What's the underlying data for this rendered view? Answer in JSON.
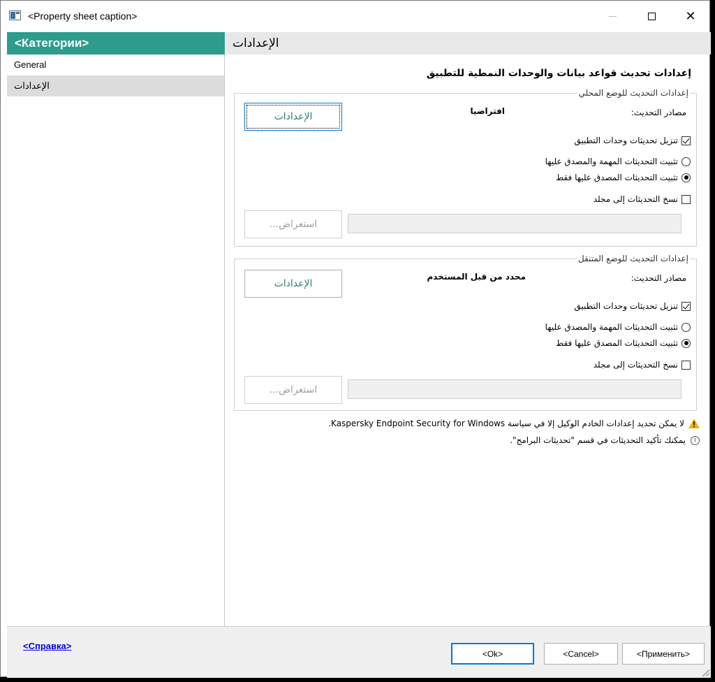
{
  "window": {
    "title": "<Property sheet caption>",
    "controls": {
      "minimize_icon": "minimize-icon",
      "maximize_icon": "maximize-icon",
      "close_glyph": "✕"
    }
  },
  "sidebar": {
    "header": "<Категории>",
    "items": [
      {
        "label": "General",
        "selected": false
      },
      {
        "label": "الإعدادات",
        "selected": true
      }
    ]
  },
  "page": {
    "header": "الإعدادات",
    "title": "إعدادات تحديث قواعد بيانات والوحدات النمطية للتطبيق"
  },
  "local_group": {
    "title": "إعدادات التحديث للوضع المحلي",
    "settings_button": "الإعدادات",
    "source_label": "مصادر التحديث:",
    "source_value": "افتراضيا",
    "download_modules": {
      "label": "تنزيل تحديثات وحدات التطبيق",
      "checked": true
    },
    "install_critical": {
      "label": "تثبيت التحديثات المهمة والمصدق عليها",
      "selected": false
    },
    "install_approved": {
      "label": "تثبيت التحديثات المصدق عليها فقط",
      "selected": true
    },
    "copy_to_folder": {
      "label": "نسخ التحديثات إلى مجلد",
      "checked": false
    },
    "folder_path": "",
    "browse_button": "استعراض..."
  },
  "mobile_group": {
    "title": "إعدادات التحديث للوضع المتنقل",
    "settings_button": "الإعدادات",
    "source_label": "مصادر التحديث:",
    "source_value": "محدد من قبل المستخدم",
    "download_modules": {
      "label": "تنزيل تحديثات وحدات التطبيق",
      "checked": true
    },
    "install_critical": {
      "label": "تثبيت التحديثات المهمة والمصدق عليها",
      "selected": false
    },
    "install_approved": {
      "label": "تثبيت التحديثات المصدق عليها فقط",
      "selected": true
    },
    "copy_to_folder": {
      "label": "نسخ التحديثات إلى مجلد",
      "checked": false
    },
    "folder_path": "",
    "browse_button": "استعراض..."
  },
  "notes": {
    "warning": "لا يمكن تحديد إعدادات الخادم الوكيل إلا في سياسة Kaspersky Endpoint Security for Windows.",
    "info": "يمكنك تأكيد التحديثات في قسم \"تحديثات البرامج\".",
    "warning_icon": "warning-icon",
    "info_icon": "info-icon",
    "warning_color": "#f0b400"
  },
  "footer": {
    "help_link": "<Справка>",
    "ok": "<Ok>",
    "cancel": "<Cancel>",
    "apply": "<Применить>"
  },
  "colors": {
    "accent": "#2d9c8c",
    "accent_text": "#2b7d6f",
    "selection": "#dcdcdc"
  }
}
